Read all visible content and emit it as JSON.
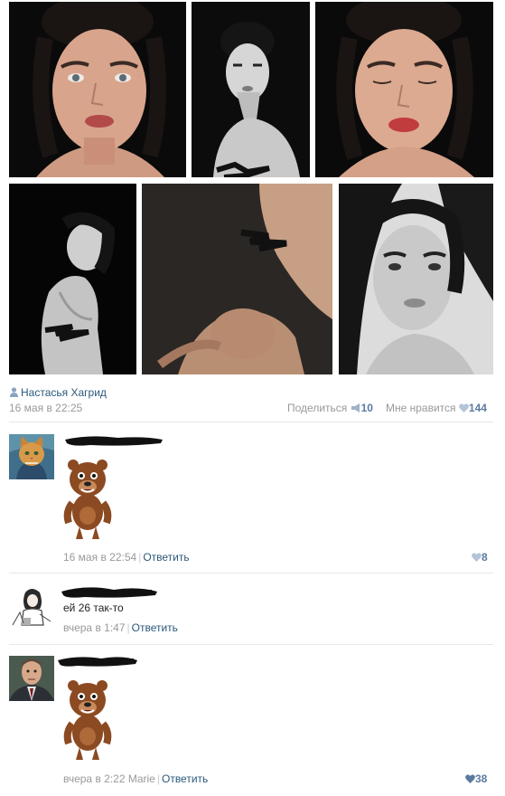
{
  "post": {
    "author": "Настасья Хагрид",
    "date": "16 мая в 22:25",
    "share_label": "Поделиться",
    "share_count": "10",
    "like_label": "Мне нравится",
    "like_count": "144"
  },
  "comments": [
    {
      "text": "",
      "date": "16 мая в 22:54",
      "reply_label": "Ответить",
      "likes": "8",
      "avatar_icon": "cat-painting-avatar",
      "sticker_icon": "bear-sticker"
    },
    {
      "text": "ей 26 так-то",
      "date": "вчера в 1:47",
      "reply_label": "Ответить",
      "avatar_icon": "girl-drawing-avatar"
    },
    {
      "text": "",
      "date": "вчера в 2:22 Marie",
      "reply_label": "Ответить",
      "likes": "38",
      "avatar_icon": "man-portrait-avatar",
      "sticker_icon": "bear-sticker"
    }
  ],
  "colors": {
    "link": "#2b587a",
    "meta": "#999999",
    "like_heart": "#5b7aa0",
    "separator": "#e7e8ec"
  }
}
